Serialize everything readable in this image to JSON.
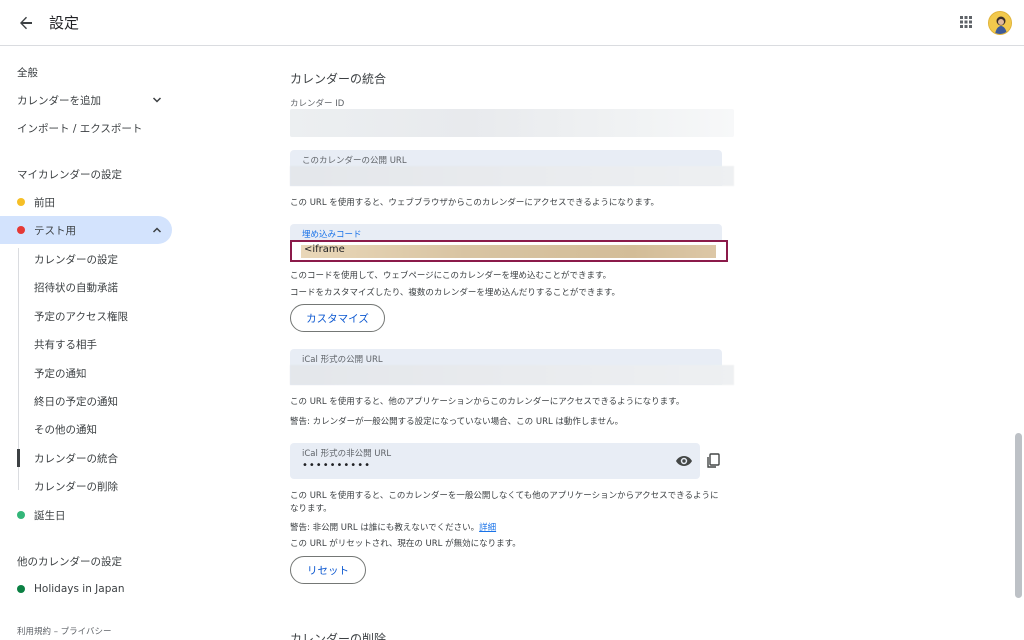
{
  "header": {
    "title": "設定"
  },
  "sidebar": {
    "items": [
      {
        "label": "全般"
      },
      {
        "label": "カレンダーを追加"
      },
      {
        "label": "インポート / エクスポート"
      }
    ],
    "my_calendars_heading": "マイカレンダーの設定",
    "my_calendars": [
      {
        "label": "前田",
        "color": "#f6bf26"
      },
      {
        "label": "テスト用",
        "color": "#e67c73"
      },
      {
        "label": "誕生日",
        "color": "#33b679"
      }
    ],
    "sub_items": [
      {
        "label": "カレンダーの設定"
      },
      {
        "label": "招待状の自動承諾"
      },
      {
        "label": "予定のアクセス権限"
      },
      {
        "label": "共有する相手"
      },
      {
        "label": "予定の通知"
      },
      {
        "label": "終日の予定の通知"
      },
      {
        "label": "その他の通知"
      },
      {
        "label": "カレンダーの統合"
      },
      {
        "label": "カレンダーの削除"
      }
    ],
    "other_calendars_heading": "他のカレンダーの設定",
    "other_calendars": [
      {
        "label": "Holidays in Japan",
        "color": "#0b8043"
      }
    ],
    "footer": "利用規約 – プライバシー"
  },
  "main": {
    "section_title": "カレンダーの統合",
    "calendar_id_label": "カレンダー ID",
    "public_url_label": "このカレンダーの公開 URL",
    "public_url_desc": "この URL を使用すると、ウェブブラウザからこのカレンダーにアクセスできるようになります。",
    "embed_label": "埋め込みコード",
    "embed_value": "<iframe",
    "embed_desc1": "このコードを使用して、ウェブページにこのカレンダーを埋め込むことができます。",
    "embed_desc2": "コードをカスタマイズしたり、複数のカレンダーを埋め込んだりすることができます。",
    "customize_button": "カスタマイズ",
    "ical_public_label": "iCal 形式の公開 URL",
    "ical_public_desc": "この URL を使用すると、他のアプリケーションからこのカレンダーにアクセスできるようになります。",
    "ical_public_warning": "警告: カレンダーが一般公開する設定になっていない場合、この URL は動作しません。",
    "ical_secret_label": "iCal 形式の非公開 URL",
    "ical_secret_value": "••••••••••",
    "ical_secret_desc1": "この URL を使用すると、このカレンダーを一般公開しなくても他のアプリケーションからアクセスできるように",
    "ical_secret_desc2": "なります。",
    "ical_secret_warning": "警告: 非公開 URL は誰にも教えないでください。",
    "details_link": "詳細",
    "reset_desc": "この URL がリセットされ、現在の URL が無効になります。",
    "reset_button": "リセット",
    "next_section_title": "カレンダーの削除"
  }
}
